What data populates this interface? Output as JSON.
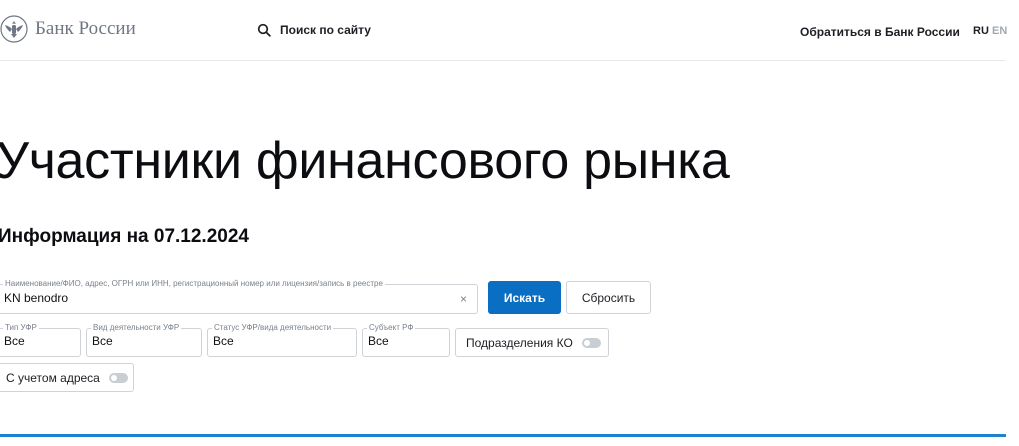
{
  "header": {
    "logo_text": "Банк России",
    "site_search_label": "Поиск по сайту",
    "contact_link": "Обратиться в Банк России",
    "lang_ru": "RU",
    "lang_en": "EN"
  },
  "main": {
    "title": "Участники финансового рынка",
    "info_date": "Информация на 07.12.2024"
  },
  "search_form": {
    "query_label": "Наименование/ФИО, адрес, ОГРН или ИНН, регистрационный номер или лицензия/запись в реестре",
    "query_value": "KN benodro",
    "clear_symbol": "×",
    "search_button": "Искать",
    "reset_button": "Сбросить"
  },
  "filters": {
    "type": {
      "label": "Тип УФР",
      "value": "Все"
    },
    "activity": {
      "label": "Вид деятельности УФР",
      "value": "Все"
    },
    "status": {
      "label": "Статус УФР/вида деятельности",
      "value": "Все"
    },
    "subject": {
      "label": "Субъект РФ",
      "value": "Все"
    },
    "divisions_toggle": {
      "label": "Подразделения КО",
      "on": false
    },
    "address_toggle": {
      "label": "С учетом адреса",
      "on": false
    }
  },
  "colors": {
    "accent": "#0a6fc2",
    "divider": "#1d82cf",
    "muted_text": "#6e7783"
  }
}
